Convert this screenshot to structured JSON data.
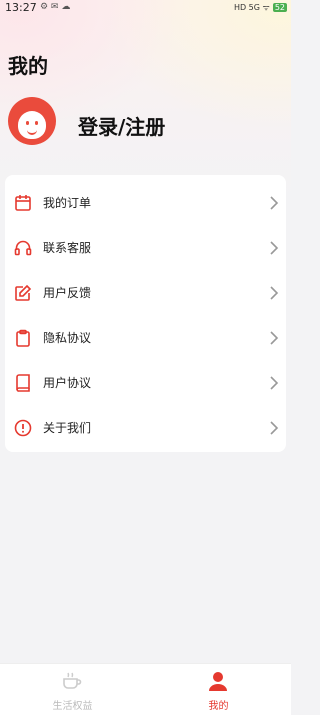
{
  "status_bar": {
    "time": "13:27",
    "left_icons_text": "⚙ ✉ ☁",
    "signal_text": "HD 5G ᯤ",
    "battery": "52"
  },
  "page": {
    "title": "我的"
  },
  "profile": {
    "login_label": "登录/注册"
  },
  "menu": {
    "items": [
      {
        "label": "我的订单",
        "icon": "calendar-icon"
      },
      {
        "label": "联系客服",
        "icon": "headset-icon"
      },
      {
        "label": "用户反馈",
        "icon": "edit-icon"
      },
      {
        "label": "隐私协议",
        "icon": "clipboard-icon"
      },
      {
        "label": "用户协议",
        "icon": "book-icon"
      },
      {
        "label": "关于我们",
        "icon": "info-icon"
      }
    ]
  },
  "tabbar": {
    "tabs": [
      {
        "label": "生活权益",
        "active": false
      },
      {
        "label": "我的",
        "active": true
      }
    ]
  },
  "colors": {
    "accent": "#e5392f",
    "avatar": "#ea4b3c",
    "inactive": "#bbbbbb"
  }
}
